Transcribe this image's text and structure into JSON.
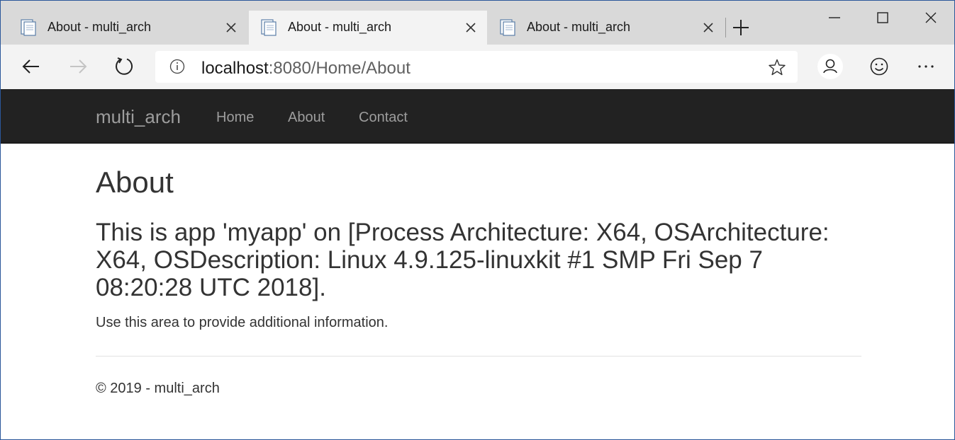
{
  "browser": {
    "tabs": [
      {
        "title": "About - multi_arch",
        "active": false
      },
      {
        "title": "About - multi_arch",
        "active": true
      },
      {
        "title": "About - multi_arch",
        "active": false
      }
    ],
    "address": {
      "host": "localhost",
      "rest": ":8080/Home/About"
    },
    "icons": {
      "back": "arrow-left-icon",
      "forward": "arrow-right-icon",
      "refresh": "refresh-icon",
      "info": "info-icon",
      "favorite": "star-icon",
      "profile": "person-icon",
      "feedback": "smiley-icon",
      "more": "more-icon",
      "new_tab": "plus-icon",
      "minimize": "minimize-icon",
      "maximize": "maximize-icon",
      "close": "close-icon"
    }
  },
  "site": {
    "brand": "multi_arch",
    "nav": [
      "Home",
      "About",
      "Contact"
    ],
    "colors": {
      "navbar_bg": "#222222",
      "nav_text": "#9d9d9d",
      "text": "#333333"
    }
  },
  "page": {
    "title": "About",
    "message": "This is app 'myapp' on [Process Architecture: X64, OSArchitecture: X64, OSDescription: Linux 4.9.125-linuxkit #1 SMP Fri Sep 7 08:20:28 UTC 2018].",
    "info": "Use this area to provide additional information.",
    "footer": "© 2019 - multi_arch"
  }
}
